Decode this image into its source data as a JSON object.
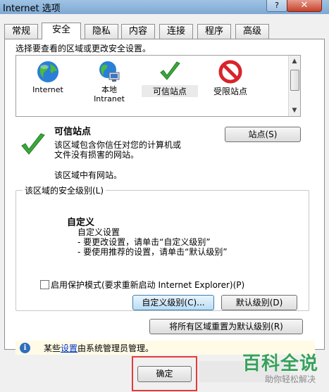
{
  "window": {
    "title": "Internet 选项",
    "help": "?",
    "close": "✕"
  },
  "tabs": [
    {
      "label": "常规"
    },
    {
      "label": "安全"
    },
    {
      "label": "隐私"
    },
    {
      "label": "内容"
    },
    {
      "label": "连接"
    },
    {
      "label": "程序"
    },
    {
      "label": "高级"
    }
  ],
  "zones": {
    "label": "选择要查看的区域或更改安全设置。",
    "items": [
      {
        "label": "Internet",
        "icon": "globe-icon"
      },
      {
        "label": "本地\nIntranet",
        "icon": "intranet-globe-icon"
      },
      {
        "label": "可信站点",
        "icon": "checkmark-icon"
      },
      {
        "label": "受限站点",
        "icon": "no-entry-icon"
      }
    ]
  },
  "site": {
    "title": "可信站点",
    "button": "站点(S)",
    "desc_line1": "该区域包含你信任对您的计算机或",
    "desc_line2": "文件没有损害的网站。",
    "note": "该区域中有网站。"
  },
  "level": {
    "group_label": "该区域的安全级别(L)",
    "title": "自定义",
    "line1": "自定义设置",
    "line2": "- 要更改设置，请单击“自定义级别”",
    "line3": "- 要使用推荐的设置，请单击“默认级别”"
  },
  "protected_mode": {
    "label": "启用保护模式(要求重新启动 Internet Explorer)(P)",
    "checked": false
  },
  "buttons": {
    "custom": "自定义级别(C)...",
    "default": "默认级别(D)",
    "reset_all": "将所有区域重置为默认级别(R)",
    "ok": "确定"
  },
  "info": {
    "prefix": "某些",
    "link": "设置",
    "suffix": "由系统管理员管理。"
  },
  "watermark": {
    "big": "百科全说",
    "small": "助你轻松解决"
  },
  "colors": {
    "accent": "#3c7fb1",
    "highlight": "#e23b3b",
    "watermark": "#37a15a"
  }
}
